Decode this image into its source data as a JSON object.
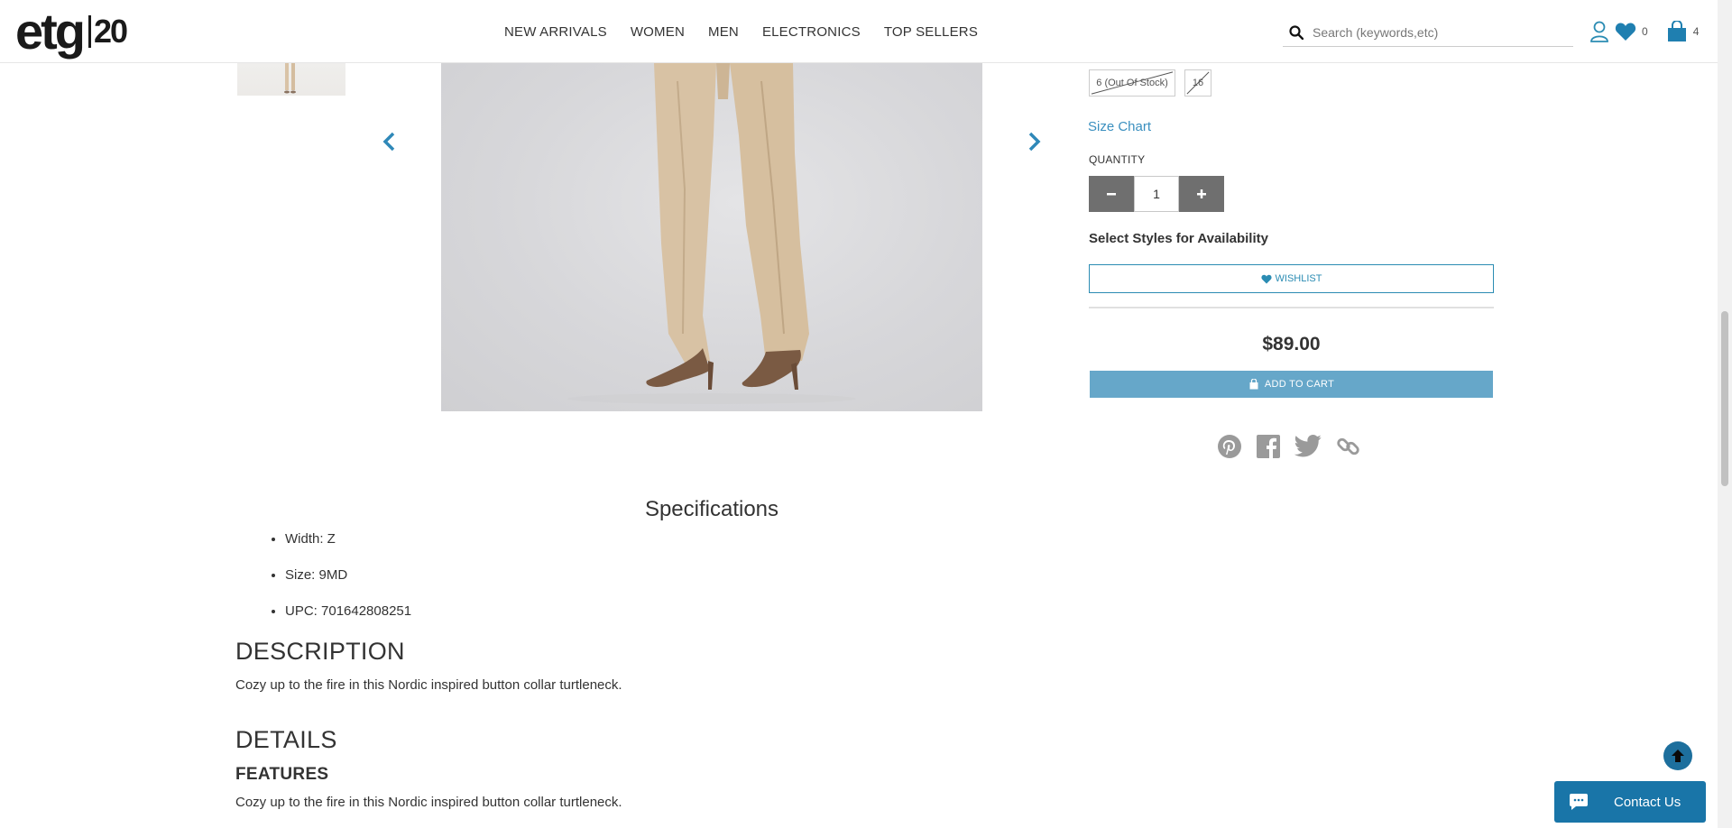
{
  "header": {
    "logo_text": "etg",
    "logo_badge": "20",
    "nav": [
      "NEW ARRIVALS",
      "WOMEN",
      "MEN",
      "ELECTRONICS",
      "TOP SELLERS"
    ],
    "search_placeholder": "Search (keywords,etc)",
    "wishlist_count": "0",
    "cart_count": "4"
  },
  "sizes": [
    {
      "label": "6 (Out Of Stock)",
      "available": false
    },
    {
      "label": "16",
      "available": false
    }
  ],
  "product": {
    "size_chart_label": "Size Chart",
    "quantity_label": "QUANTITY",
    "quantity_value": "1",
    "availability_text": "Select Styles for Availability",
    "wishlist_label": "WISHLIST",
    "price": "$89.00",
    "add_to_cart_label": "ADD TO CART"
  },
  "specifications": {
    "title": "Specifications",
    "items": [
      "Width: Z",
      "Size: 9MD",
      "UPC: 701642808251"
    ]
  },
  "description": {
    "heading": "DESCRIPTION",
    "text": "Cozy up to the fire in this Nordic inspired button collar turtleneck."
  },
  "details": {
    "heading": "DETAILS",
    "features_heading": "FEATURES",
    "features_text": "Cozy up to the fire in this Nordic inspired button collar turtleneck."
  },
  "contact_label": "Contact Us",
  "colors": {
    "accent": "#2b8cb3",
    "add_to_cart_bg": "#66a7c9",
    "contact_bg": "#1975a8",
    "qty_button_bg": "#6f6f6f"
  }
}
